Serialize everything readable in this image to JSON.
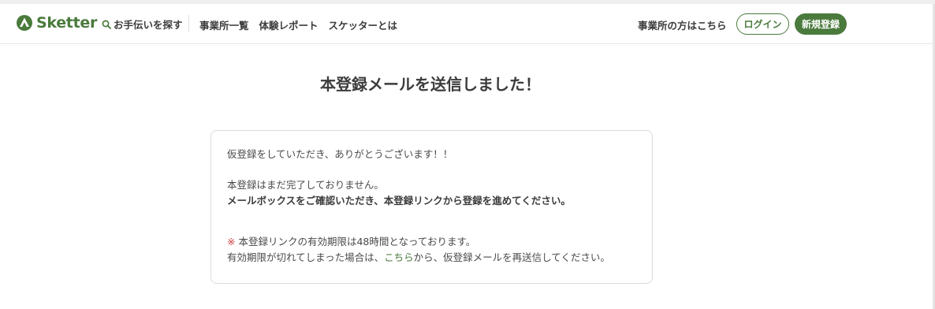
{
  "header": {
    "logo_text": "Sketter",
    "search_label": "お手伝いを探す",
    "nav": [
      "事業所一覧",
      "体験レポート",
      "スケッターとは"
    ],
    "business_link": "事業所の方はこちら",
    "login_label": "ログイン",
    "register_label": "新規登録"
  },
  "main": {
    "title": "本登録メールを送信しました！",
    "message": {
      "thanks": "仮登録をしていただき、ありがとうございます！！",
      "not_complete": "本登録はまだ完了しておりません。",
      "instruction": "メールボックスをご確認いただき、本登録リンクから登録を進めてください。",
      "note_mark": "※",
      "note_text": " 本登録リンクの有効期限は48時間となっております。",
      "expired_prefix": "有効期限が切れてしまった場合は、",
      "expired_link": "こちら",
      "expired_suffix": "から、仮登録メールを再送信してください。"
    }
  },
  "colors": {
    "brand_green": "#4a7a3c",
    "note_red": "#d04040",
    "text": "#3c3c3c"
  }
}
